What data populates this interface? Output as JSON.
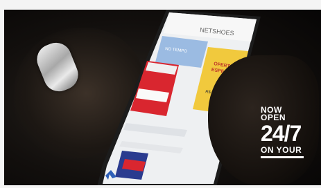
{
  "phone_screen": {
    "brand": "NETSHOES",
    "side_card_text": "NO TEMPO",
    "banner_text": "OFERTA\nESPECIAL",
    "banner_price": "R$ 29,90"
  },
  "promo": {
    "line1": "NOW",
    "line2": "OPEN",
    "big": "24/7",
    "line3": "ON YOUR"
  },
  "colors": {
    "banner_yellow": "#f1c93d",
    "side_card_blue": "#9bbbe2",
    "product_red": "#d9262f"
  }
}
